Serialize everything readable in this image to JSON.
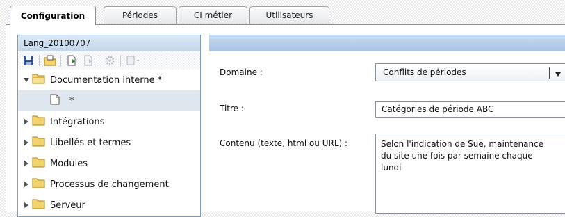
{
  "tabs": [
    {
      "label": "Configuration",
      "active": true
    },
    {
      "label": "Périodes"
    },
    {
      "label": "CI métier"
    },
    {
      "label": "Utilisateurs"
    }
  ],
  "left_panel": {
    "title": "Lang_20100707",
    "toolbar": [
      "save-icon",
      "open-folder-icon",
      "new-document-icon",
      "copy-icon",
      "settings-icon",
      "export-icon"
    ],
    "tree": [
      {
        "label": "Documentation interne *",
        "expanded": true
      },
      {
        "label": "*",
        "child": true
      },
      {
        "label": "Intégrations"
      },
      {
        "label": "Libellés et termes"
      },
      {
        "label": "Modules"
      },
      {
        "label": "Processus de changement"
      },
      {
        "label": "Serveur"
      }
    ]
  },
  "form": {
    "domain_label": "Domaine :",
    "domain_value": "Conflits de périodes",
    "title_label": "Titre :",
    "title_value": "Catégories de période ABC",
    "content_label": "Contenu (texte, html ou URL) :",
    "content_value": "Selon l'indication de Sue, maintenance\ndu site une fois par semaine chaque\nlundi"
  },
  "colors": {
    "header_blue": "#c5d7ea",
    "bar_blue": "#a9c4e3",
    "selected_row": "#dfe6ee",
    "folder_yellow": "#f3d36b"
  }
}
